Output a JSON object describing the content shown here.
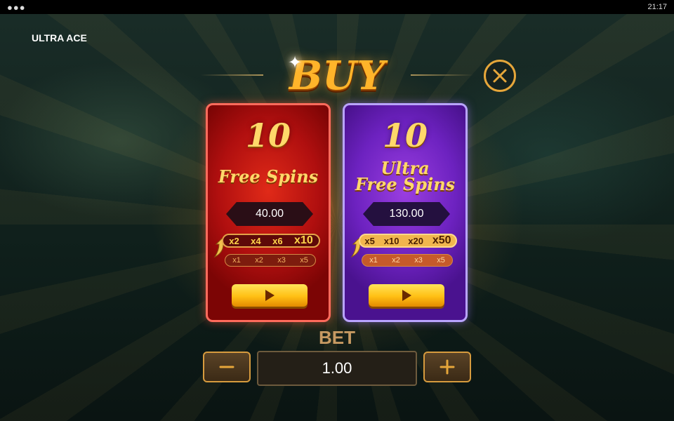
{
  "status_bar": {
    "menu_icon": "more-dots-icon",
    "time": "21:17"
  },
  "app": {
    "title": "ULTRA ACE"
  },
  "dialog": {
    "title": "BUY",
    "close_icon": "close-icon"
  },
  "options": [
    {
      "count": "10",
      "label_lines": [
        "Free Spins"
      ],
      "price": "40.00",
      "multipliers": [
        "x2",
        "x4",
        "x6",
        "x10"
      ],
      "base_multipliers": [
        "x1",
        "x2",
        "x3",
        "x5"
      ],
      "theme": "#b00f0f"
    },
    {
      "count": "10",
      "label_lines": [
        "Ultra",
        "Free Spins"
      ],
      "price": "130.00",
      "multipliers": [
        "x5",
        "x10",
        "x20",
        "x50"
      ],
      "base_multipliers": [
        "x1",
        "x2",
        "x3",
        "x5"
      ],
      "theme": "#6d22c0"
    }
  ],
  "bet": {
    "label": "BET",
    "value": "1.00",
    "minus_icon": "minus-icon",
    "plus_icon": "plus-icon"
  },
  "colors": {
    "gold": "#ffb42a",
    "button_border": "#d79b3e"
  }
}
